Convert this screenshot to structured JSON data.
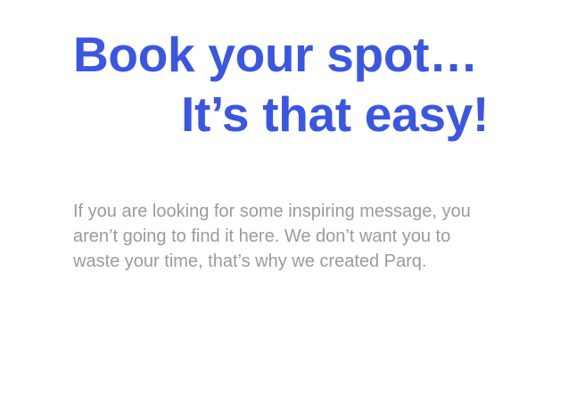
{
  "hero": {
    "headline_line_1": "Book your spot…",
    "headline_line_2": "It’s that easy!",
    "body_lines": [
      "If you are looking for some inspiring message, you",
      "aren’t going to find it here. We don’t want you to",
      "waste your time, that’s why we created Parq."
    ]
  },
  "colors": {
    "headline": "#3a56e4",
    "body_text": "#9b9b9b",
    "background": "#ffffff"
  }
}
